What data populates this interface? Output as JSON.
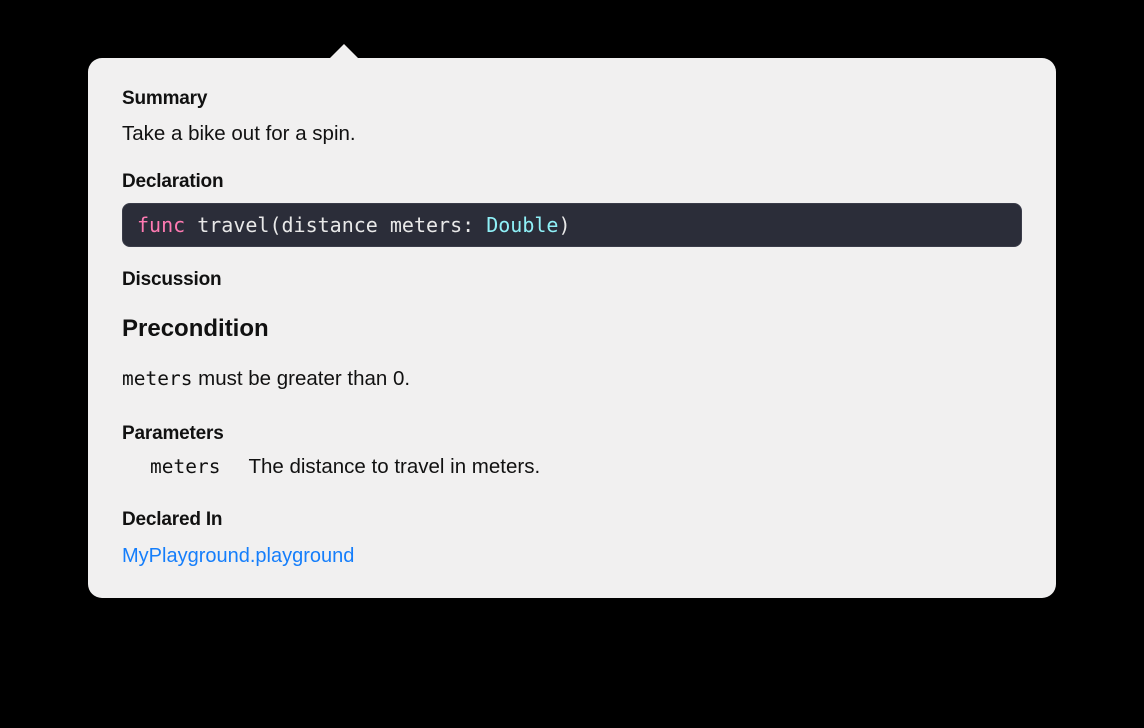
{
  "summary": {
    "heading": "Summary",
    "text": "Take a bike out for a spin."
  },
  "declaration": {
    "heading": "Declaration",
    "tokens": {
      "keyword": "func",
      "sp1": " ",
      "name_open": "travel(distance meters: ",
      "type": "Double",
      "close": ")"
    }
  },
  "discussion": {
    "heading": "Discussion",
    "subheading": "Precondition",
    "text_mono": "meters",
    "text_rest": " must be greater than 0."
  },
  "parameters": {
    "heading": "Parameters",
    "items": [
      {
        "name": "meters",
        "description": "The distance to travel in meters."
      }
    ]
  },
  "declared_in": {
    "heading": "Declared In",
    "link_text": "MyPlayground.playground"
  }
}
